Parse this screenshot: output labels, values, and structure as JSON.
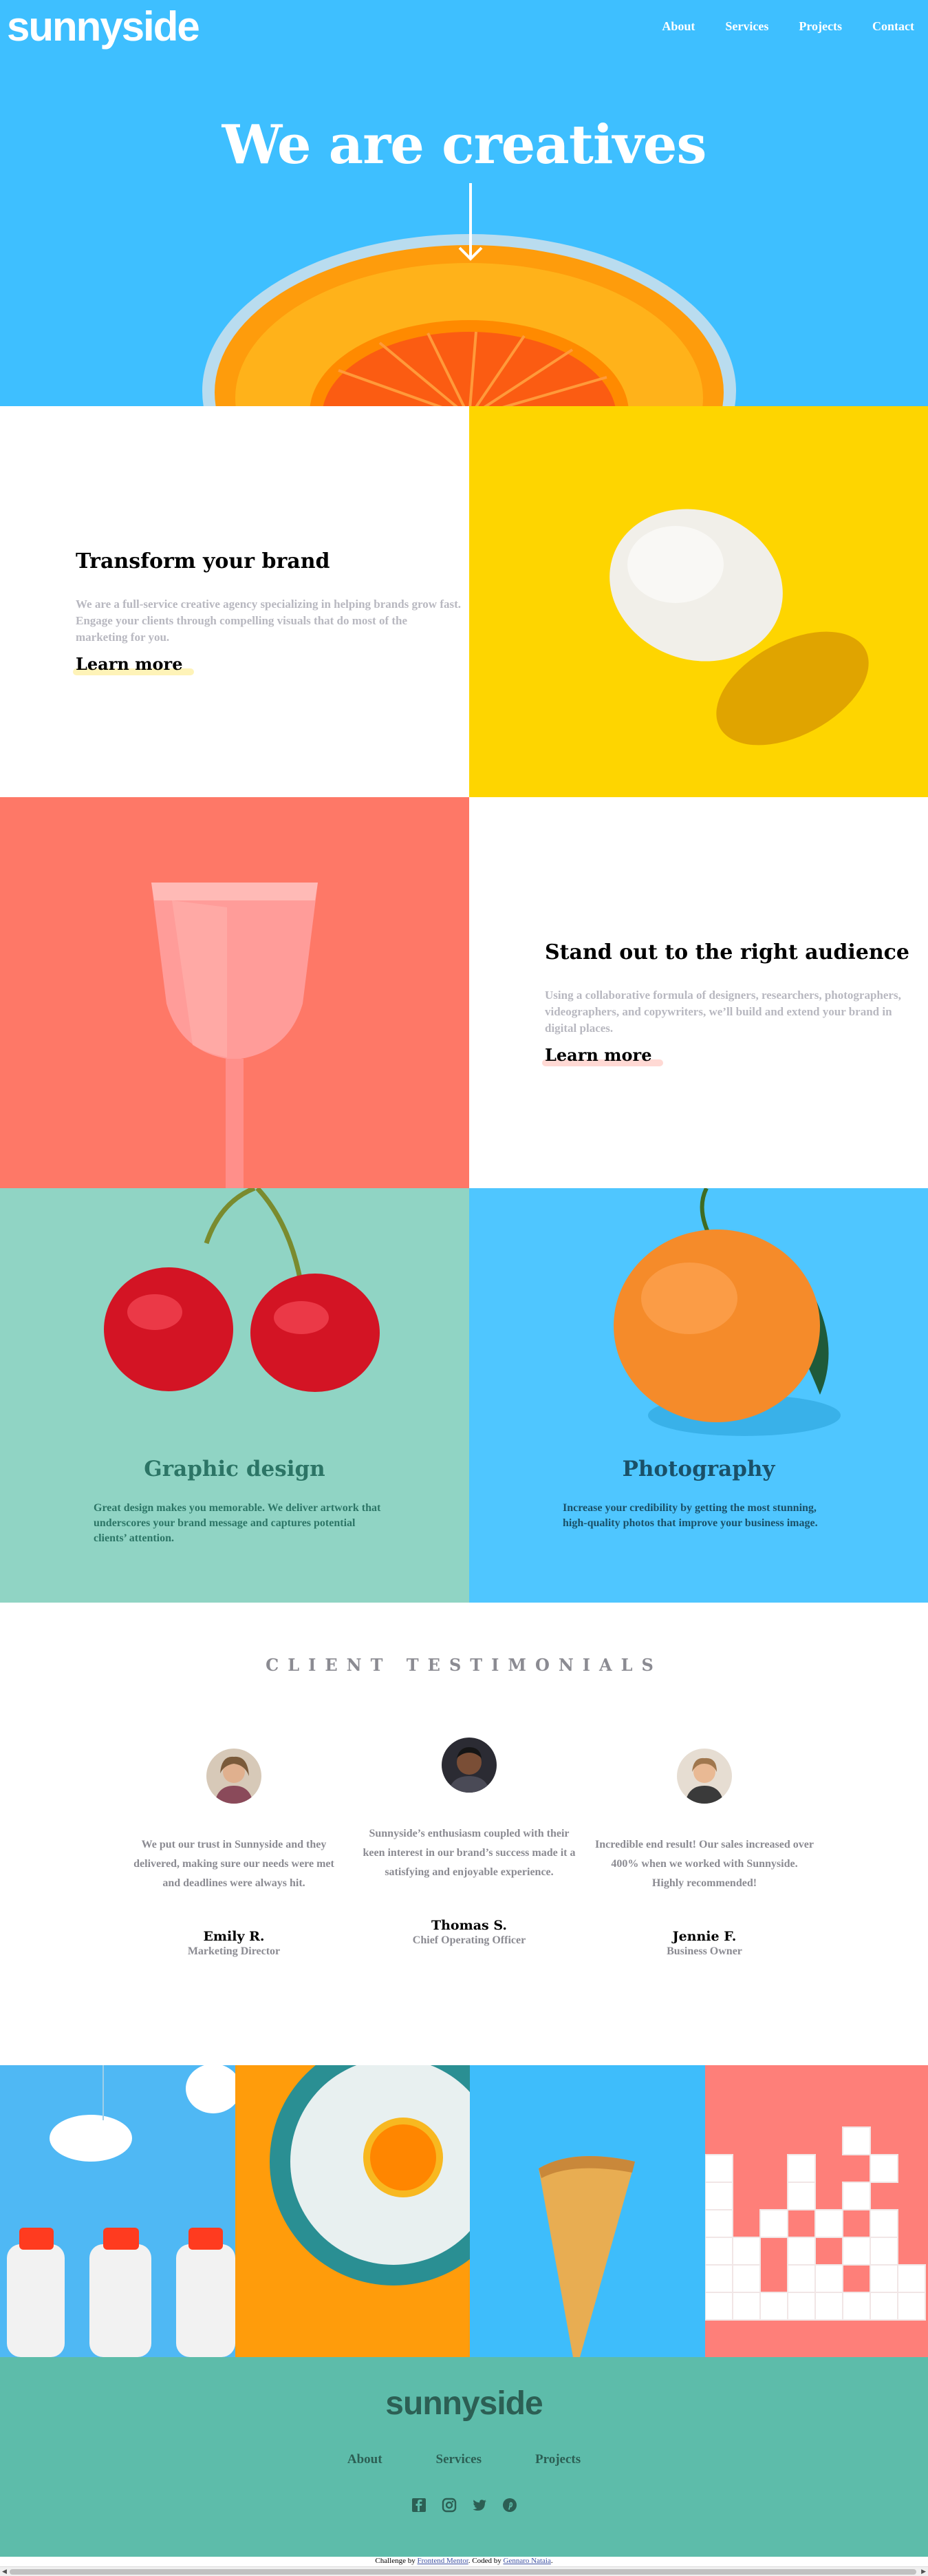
{
  "brand": {
    "logo": "sunnyside"
  },
  "nav": {
    "items": [
      "About",
      "Services",
      "Projects",
      "Contact"
    ]
  },
  "hero": {
    "title": "We are creatives"
  },
  "features": [
    {
      "title": "Transform your brand",
      "body": "We are a full-service creative agency specializing in helping brands grow fast. Engage your clients through compelling visuals that do most of the marketing for you.",
      "link": "Learn more",
      "accent": "#fad400"
    },
    {
      "title": "Stand out to the right audience",
      "body": "Using a collaborative formula of designers, researchers, photographers, videographers, and copywriters, we’ll build and extend your brand in digital places.",
      "link": "Learn more",
      "accent": "#fe7865"
    }
  ],
  "services": [
    {
      "title": "Graphic design",
      "body": "Great design makes you memorable. We deliver artwork that underscores your brand message and captures potential clients’ attention.",
      "color": "#2c7566"
    },
    {
      "title": "Photography",
      "body": "Increase your credibility by getting the most stunning, high-quality photos that improve your business image.",
      "color": "#1a5068"
    }
  ],
  "testimonials": {
    "heading": "CLIENT TESTIMONIALS",
    "items": [
      {
        "quote": "We put our trust in Sunnyside and they delivered, making sure our needs were met and deadlines were always hit.",
        "name": "Emily R.",
        "role": "Marketing Director"
      },
      {
        "quote": "Sunnyside’s enthusiasm coupled with their keen interest in our brand’s success made it a satisfying and enjoyable experience.",
        "name": "Thomas S.",
        "role": "Chief Operating Officer"
      },
      {
        "quote": "Incredible end result! Our sales increased over 400% when we worked with Sunnyside. Highly recommended!",
        "name": "Jennie F.",
        "role": "Business Owner"
      }
    ]
  },
  "footer": {
    "logo": "sunnyside",
    "nav": [
      "About",
      "Services",
      "Projects"
    ],
    "social": [
      "facebook-icon",
      "instagram-icon",
      "twitter-icon",
      "pinterest-icon"
    ]
  },
  "attribution": {
    "prefix": "Challenge by",
    "challenge_link": "Frontend Mentor",
    "middle": ". Coded by",
    "author_link": "Gennaro Nataia",
    "suffix": "."
  },
  "colors": {
    "hero_blue": "#3ebfff",
    "egg_yellow": "#fed500",
    "glass_red": "#fe7867",
    "mint": "#90d4c4",
    "footer": "#5dbcaa"
  }
}
